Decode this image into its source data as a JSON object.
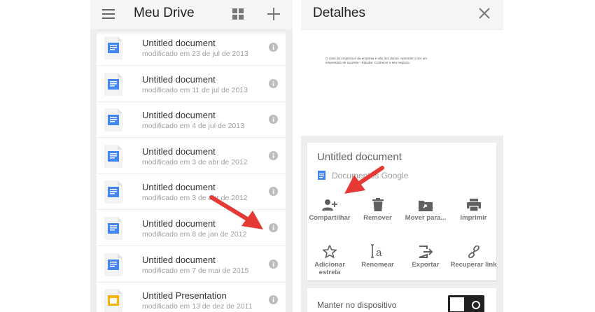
{
  "colors": {
    "doc_blue": "#4285f4",
    "slides_yellow": "#f4b400",
    "arrow_red": "#e53935"
  },
  "left": {
    "title": "Meu Drive",
    "icons": [
      "menu-icon",
      "grid-view-icon",
      "add-icon"
    ],
    "files": [
      {
        "name": "Untitled document",
        "modified": "modificado em 23 de jul de 2013",
        "type": "document"
      },
      {
        "name": "Untitled document",
        "modified": "modificado em 11 de jul de 2013",
        "type": "document"
      },
      {
        "name": "Untitled document",
        "modified": "modificado em 4 de jul de 2013",
        "type": "document"
      },
      {
        "name": "Untitled document",
        "modified": "modificado em 3 de abr de 2012",
        "type": "document"
      },
      {
        "name": "Untitled document",
        "modified": "modificado em 3 de abr de 2012",
        "type": "document"
      },
      {
        "name": "Untitled document",
        "modified": "modificado em 8 de jan de 2012",
        "type": "document"
      },
      {
        "name": "Untitled document",
        "modified": "modificado em 7 de mai de 2015",
        "type": "document"
      },
      {
        "name": "Untitled Presentation",
        "modified": "modificado em 13 de dez de 2011",
        "type": "presentation"
      }
    ]
  },
  "right": {
    "title": "Detalhes",
    "preview_text": "O caso da empresa é da empresa e não dos donos. Aprender a ser um empresário de sucesso - Estudar. Conhecer o seu negócio.",
    "doc_title": "Untitled document",
    "doc_type": "Documentos Google",
    "actions": [
      {
        "label": "Compartilhar",
        "icon": "add-person-icon"
      },
      {
        "label": "Remover",
        "icon": "trash-icon"
      },
      {
        "label": "Mover para...",
        "icon": "move-folder-icon"
      },
      {
        "label": "Imprimir",
        "icon": "print-icon"
      },
      {
        "label": "Adicionar estrela",
        "icon": "star-icon"
      },
      {
        "label": "Renomear",
        "icon": "rename-icon"
      },
      {
        "label": "Exportar",
        "icon": "export-icon"
      },
      {
        "label": "Recuperar link",
        "icon": "link-icon"
      }
    ],
    "keep_on_device": "Manter no dispositivo"
  }
}
